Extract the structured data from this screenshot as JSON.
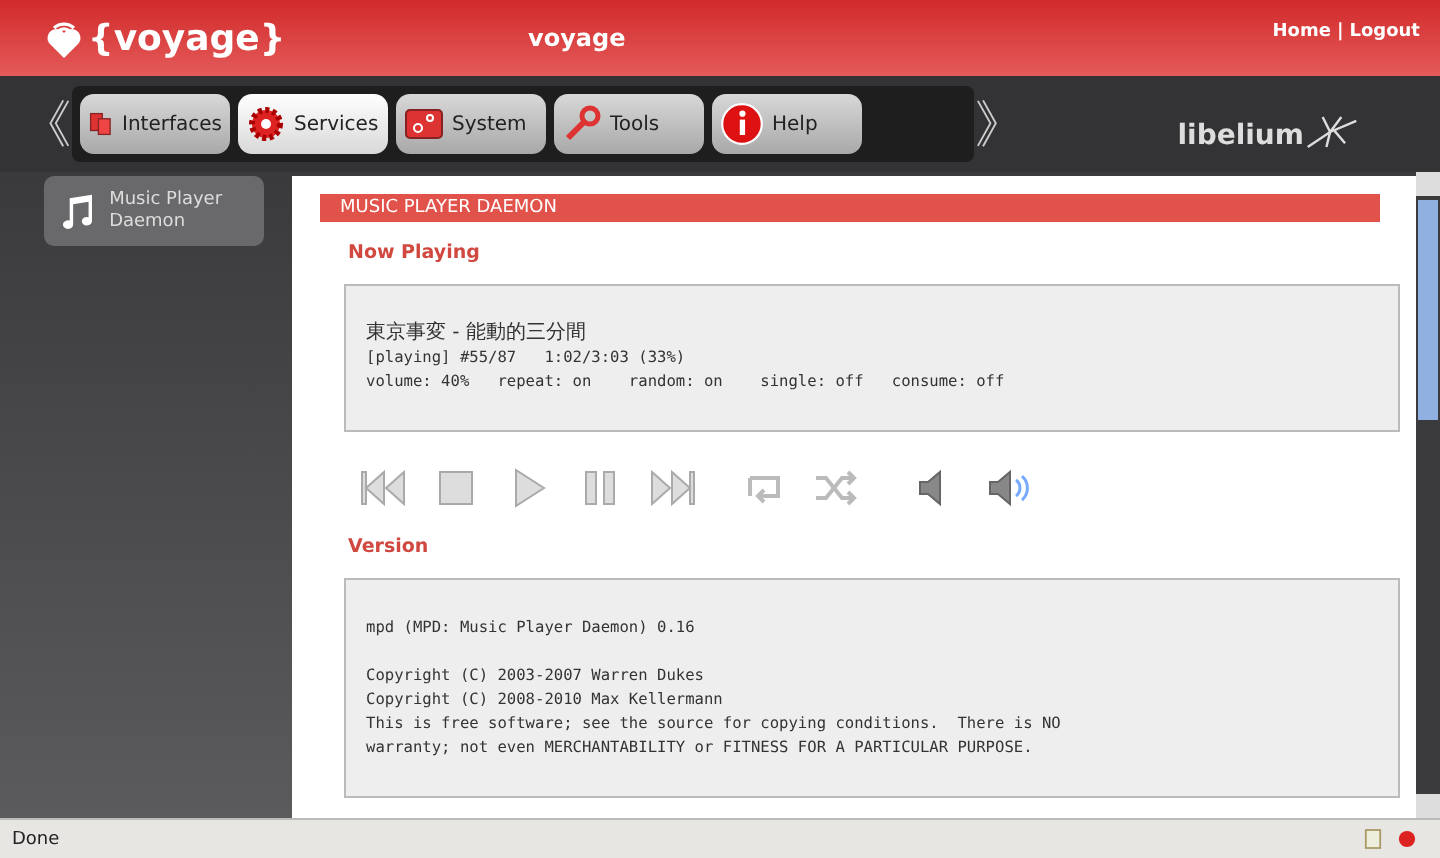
{
  "header": {
    "logo": "{voyage}",
    "hostname": "voyage",
    "links": [
      {
        "label": "Home"
      },
      {
        "label": "Logout"
      }
    ],
    "separator": "|"
  },
  "nav": {
    "prev": "《",
    "next": "》",
    "tabs": [
      {
        "label": "Interfaces",
        "kind": "interfaces",
        "selected": false
      },
      {
        "label": "Services",
        "kind": "services",
        "selected": true
      },
      {
        "label": "System",
        "kind": "system",
        "selected": false
      },
      {
        "label": "Tools",
        "kind": "tools",
        "selected": false
      },
      {
        "label": "Help",
        "kind": "help",
        "selected": false
      }
    ],
    "brand": "libelium"
  },
  "sidebar": {
    "items": [
      {
        "label": "Music Player Daemon",
        "selected": true
      }
    ]
  },
  "content": {
    "title": "MUSIC PLAYER DAEMON",
    "now_playing": {
      "heading": "Now Playing",
      "lines": [
        "東京事変 - 能動的三分間",
        "[playing] #55/87   1:02/3:03 (33%)",
        "volume: 40%   repeat: on    random: on    single: off   consume: off"
      ]
    },
    "controls": [
      {
        "kind": "prev"
      },
      {
        "kind": "stop"
      },
      {
        "kind": "play"
      },
      {
        "kind": "pause"
      },
      {
        "kind": "next"
      },
      {
        "kind": "repeat"
      },
      {
        "kind": "shuffle"
      },
      {
        "kind": "vol-down"
      },
      {
        "kind": "vol-up"
      }
    ],
    "version": {
      "heading": "Version",
      "blocks": [
        [
          "mpd (MPD: Music Player Daemon) 0.16"
        ],
        [
          "Copyright (C) 2003-2007 Warren Dukes",
          "Copyright (C) 2008-2010 Max Kellermann",
          "This is free software; see the source for copying conditions.  There is NO",
          "warranty; not even MERCHANTABILITY or FITNESS FOR A PARTICULAR PURPOSE."
        ]
      ]
    }
  },
  "status_bar": {
    "text": "Done"
  }
}
